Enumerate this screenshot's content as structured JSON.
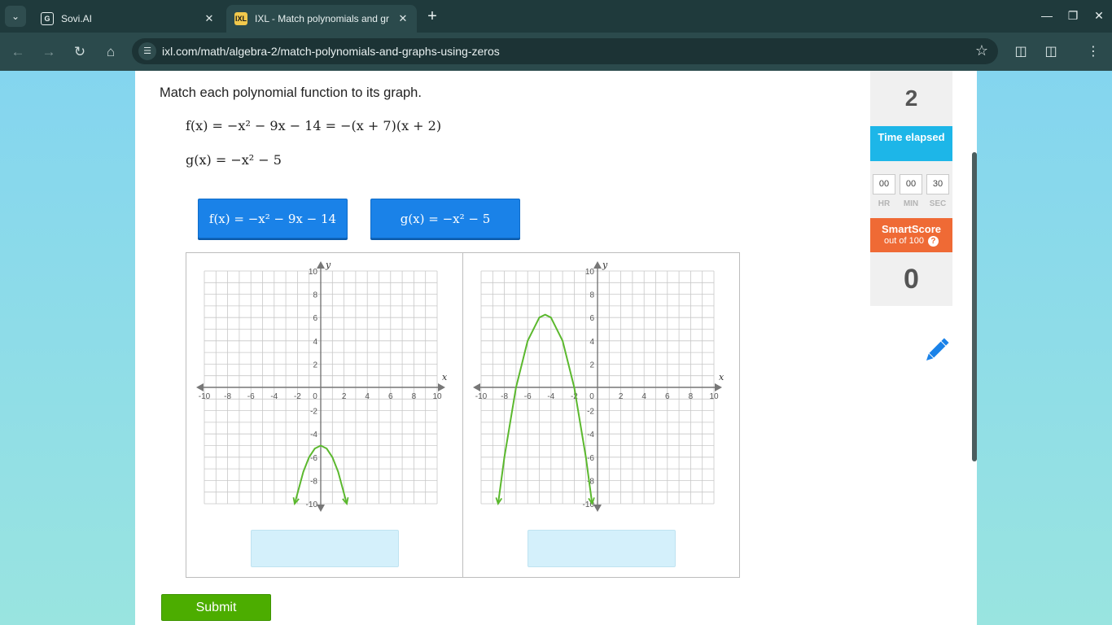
{
  "browser": {
    "tabs": [
      {
        "title": "Sovi.AI",
        "active": false
      },
      {
        "title": "IXL - Match polynomials and gr",
        "active": true
      }
    ],
    "url": "ixl.com/math/algebra-2/match-polynomials-and-graphs-using-zeros"
  },
  "question": {
    "instruction": "Match each polynomial function to its graph.",
    "f_label": "f(x) = −x² − 9x − 14 = −(x + 7)(x + 2)",
    "g_label": "g(x) = −x² − 5"
  },
  "chips": [
    {
      "label": "f(x) = −x² − 9x − 14"
    },
    {
      "label": "g(x) = −x² − 5"
    }
  ],
  "graph": {
    "x_label": "x",
    "y_label": "y",
    "x_ticks": [
      "-10",
      "-8",
      "-6",
      "-4",
      "-2",
      "0",
      "2",
      "4",
      "6",
      "8",
      "10"
    ],
    "y_ticks": [
      "10",
      "8",
      "6",
      "4",
      "2",
      "-2",
      "-4",
      "-6",
      "-8",
      "-10"
    ],
    "curve_color": "#5bb82e"
  },
  "chart_data": [
    {
      "type": "line",
      "xlabel": "x",
      "ylabel": "y",
      "xlim": [
        -10,
        10
      ],
      "ylim": [
        -10,
        10
      ],
      "grid": true,
      "series": [
        {
          "x": [
            -2.24,
            -1.5,
            -1,
            -0.5,
            0,
            0.5,
            1,
            1.5,
            2.24
          ],
          "y": [
            -10,
            -7.25,
            -6,
            -5.25,
            -5,
            -5.25,
            -6,
            -7.25,
            -10
          ]
        }
      ]
    },
    {
      "type": "line",
      "xlabel": "x",
      "ylabel": "y",
      "xlim": [
        -10,
        10
      ],
      "ylim": [
        -10,
        10
      ],
      "grid": true,
      "series": [
        {
          "x": [
            -8.54,
            -8,
            -7,
            -6,
            -5,
            -4.5,
            -4,
            -3,
            -2,
            -1,
            -0.46
          ],
          "y": [
            -10,
            -6,
            0,
            4,
            6,
            6.25,
            6,
            4,
            0,
            -6,
            -10
          ]
        }
      ]
    }
  ],
  "sidebar": {
    "questions_answered": "2",
    "time_label": "Time elapsed",
    "timer": {
      "hr": "00",
      "min": "00",
      "sec": "30",
      "hr_label": "HR",
      "min_label": "MIN",
      "sec_label": "SEC"
    },
    "smartscore_title": "SmartScore",
    "smartscore_sub": "out of 100",
    "help": "?",
    "score": "0"
  },
  "submit_label": "Submit"
}
